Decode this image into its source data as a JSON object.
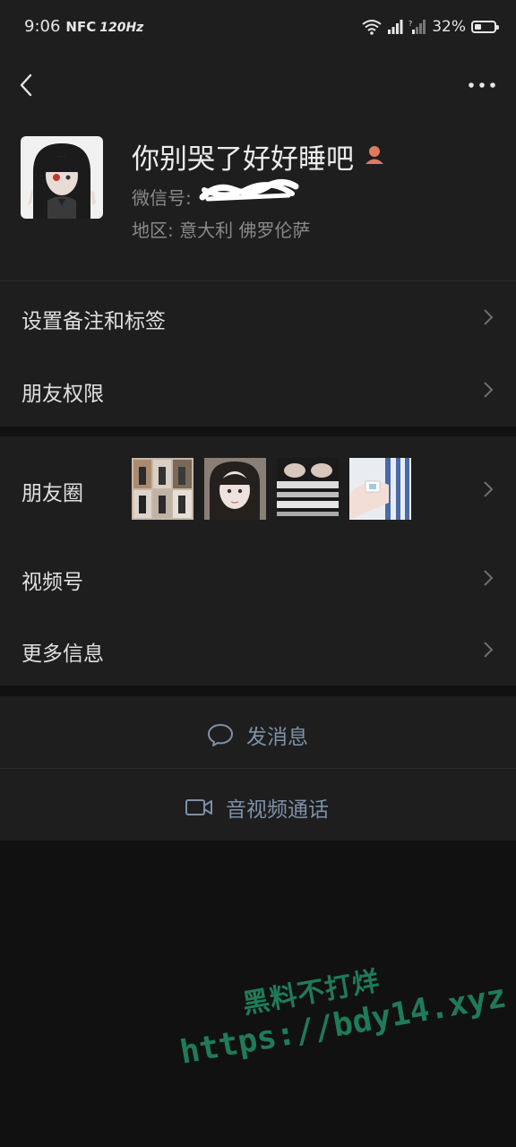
{
  "status": {
    "time": "9:06",
    "nfc": "NFC",
    "refresh": "120Hz",
    "battery": "32%",
    "battery_level": 0.32
  },
  "nav": {
    "back_icon": "back-chevron-icon",
    "more_icon": "more-dots-icon"
  },
  "profile": {
    "nickname": "你别哭了好好睡吧",
    "wechat_id_label": "微信号:",
    "region": "地区:  意大利  佛罗伦萨"
  },
  "rows": {
    "remark": "设置备注和标签",
    "permissions": "朋友权限",
    "moments": "朋友圈",
    "channels": "视频号",
    "more_info": "更多信息"
  },
  "actions": {
    "message": "发消息",
    "call": "音视频通话"
  },
  "watermark": {
    "line1": "黑料不打烊",
    "line2": "https://bdy14.xyz"
  },
  "colors": {
    "background": "#111111",
    "panel": "#1e1e1e",
    "action_text": "#7d90a8",
    "watermark": "#1f7b58"
  }
}
